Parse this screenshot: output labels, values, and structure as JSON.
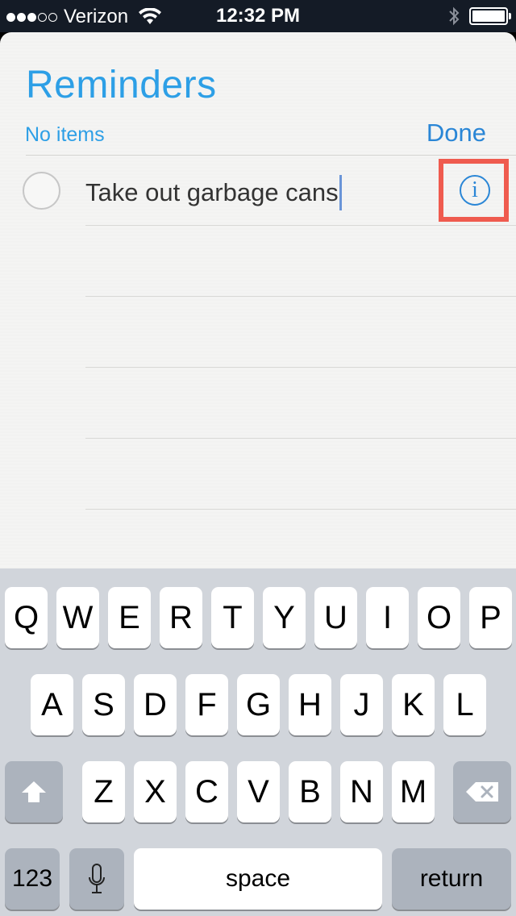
{
  "status_bar": {
    "signal_dots": [
      true,
      true,
      true,
      false,
      false
    ],
    "carrier": "Verizon",
    "time": "12:32 PM",
    "battery_level": 1.0,
    "icons": [
      "wifi-icon",
      "bluetooth-icon",
      "battery-icon"
    ]
  },
  "list": {
    "title": "Reminders",
    "items_count": "No items",
    "done_label": "Done",
    "accent_color": "#2d9fe6"
  },
  "reminder": {
    "text": "Take out garbage cans",
    "info_icon": "i"
  },
  "keyboard": {
    "row1": [
      "Q",
      "W",
      "E",
      "R",
      "T",
      "Y",
      "U",
      "I",
      "O",
      "P"
    ],
    "row2": [
      "A",
      "S",
      "D",
      "F",
      "G",
      "H",
      "J",
      "K",
      "L"
    ],
    "row3": [
      "Z",
      "X",
      "C",
      "V",
      "B",
      "N",
      "M"
    ],
    "numbers_label": "123",
    "space_label": "space",
    "return_label": "return",
    "icons": [
      "shift-icon",
      "backspace-icon",
      "microphone-icon"
    ]
  }
}
